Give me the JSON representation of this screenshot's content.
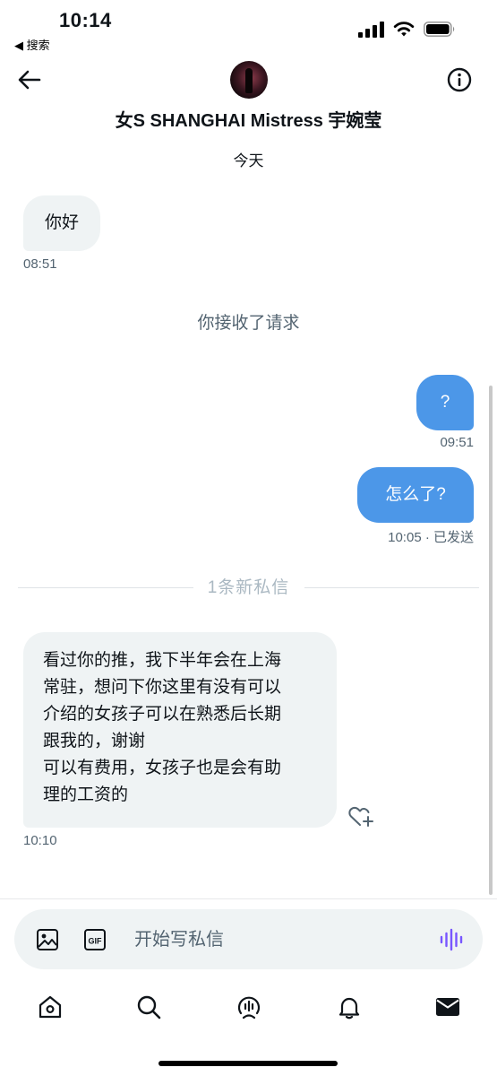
{
  "status_bar": {
    "time": "10:14",
    "back_app_label": "◀ 搜索"
  },
  "header": {
    "title": "女S SHANGHAI Mistress 宇婉莹",
    "back_icon": "arrow-left-icon",
    "info_icon": "info-circle-icon"
  },
  "conversation": {
    "day_label": "今天",
    "system_note": "你接收了请求",
    "new_messages_divider": "1条新私信",
    "messages": [
      {
        "direction": "incoming",
        "text": "你好",
        "time": "08:51"
      },
      {
        "direction": "outgoing",
        "text": "?",
        "time": "09:51"
      },
      {
        "direction": "outgoing",
        "text": "怎么了?",
        "time": "10:05 · 已发送"
      },
      {
        "direction": "incoming",
        "lines": [
          "看过你的推，我下半年会在上海",
          "常驻，想问下你这里有没有可以",
          "介绍的女孩子可以在熟悉后长期",
          "跟我的，谢谢",
          "可以有费用，女孩子也是会有助",
          "理的工资的"
        ],
        "time": "10:10"
      }
    ]
  },
  "composer": {
    "placeholder": "开始写私信",
    "image_icon": "image-icon",
    "gif_label": "GIF",
    "voice_icon": "voice-wave-icon"
  },
  "tab_bar": {
    "items": [
      "home-icon",
      "search-icon",
      "spaces-icon",
      "notifications-icon",
      "messages-icon"
    ],
    "active": "messages-icon"
  },
  "colors": {
    "outgoing_bubble": "#4c97e8",
    "incoming_bubble": "#eff3f4",
    "secondary_text": "#536471",
    "accent_voice": "#7856ff"
  }
}
